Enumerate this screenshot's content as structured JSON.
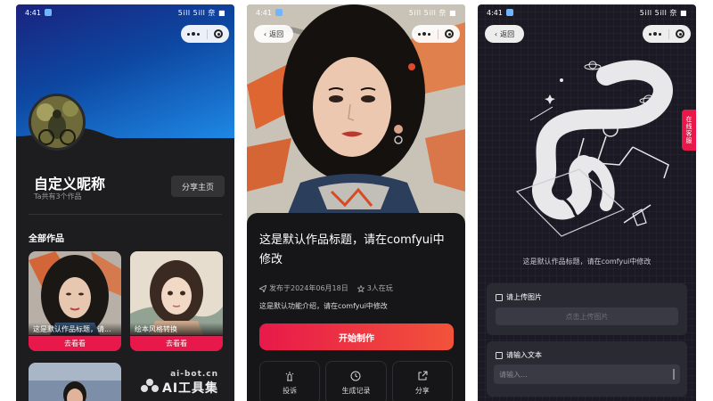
{
  "status": {
    "time": "4:41",
    "signal": "5ill 5ill 奈 ■"
  },
  "capsule_icons": [
    "more-dots-icon",
    "target-close-icon"
  ],
  "back": {
    "label": "返回"
  },
  "profile": {
    "nickname": "自定义昵称",
    "works_count": "Ta共有3个作品",
    "share_label": "分享主页",
    "section_title": "全部作品",
    "works": [
      {
        "title": "这是默认作品标题，请...",
        "action": "去看看"
      },
      {
        "title": "绘本风格转换",
        "action": "去看看"
      }
    ]
  },
  "watermark": {
    "line1": "ai-bot.cn",
    "line2": "AI工具集"
  },
  "detail": {
    "title": "这是默认作品标题，请在comfyui中修改",
    "date": "发布于2024年06月18日",
    "players": "3人在玩",
    "description": "这是默认功能介绍，请在comfyui中修改",
    "start_label": "开始制作",
    "actions": [
      {
        "label": "投诉",
        "icon": "complaint-icon"
      },
      {
        "label": "生成记录",
        "icon": "clock-icon"
      },
      {
        "label": "分享",
        "icon": "share-icon"
      }
    ]
  },
  "maker": {
    "caption": "这是默认作品标题，请在comfyui中修改",
    "side_tab": "在线客服",
    "upload_label": "请上传图片",
    "upload_button": "点击上传图片",
    "text_label": "请输入文本",
    "text_placeholder": "请输入..."
  },
  "colors": {
    "accent": "#e8194a",
    "accent2": "#f2533a",
    "header_blue": "#0d47a1"
  }
}
